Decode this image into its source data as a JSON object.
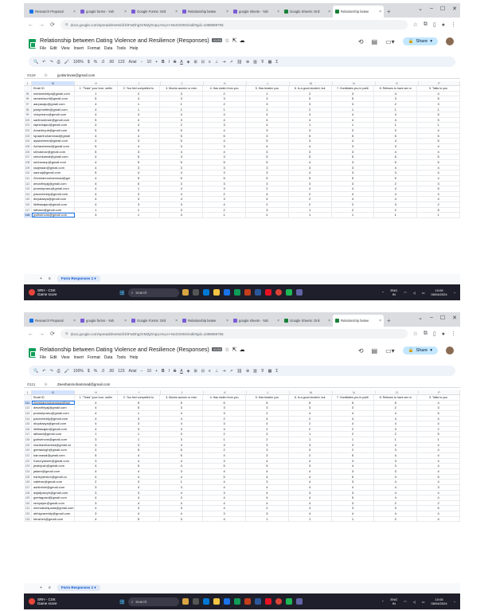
{
  "browser": {
    "tabs": [
      {
        "label": "Research Proposal"
      },
      {
        "label": "google forms - Yah"
      },
      {
        "label": "Google Forms: Onli"
      },
      {
        "label": "Relationship betwe"
      },
      {
        "label": "google sheets - Yah"
      },
      {
        "label": "Google Sheets: Onli"
      },
      {
        "label": "Relationship betwe"
      }
    ],
    "url": "docs.google.com/spreadsheets/d/1hFwDhg3VMZjZmpq-Imq-H-NeO3H5G/edit#gid=1098989706"
  },
  "doc": {
    "title": "Relationship between Dating Violence and Resilience (Responses)",
    "badge": ".XLSX",
    "menus": [
      "File",
      "Edit",
      "View",
      "Insert",
      "Format",
      "Data",
      "Tools",
      "Help"
    ],
    "share_label": "Share"
  },
  "toolbar": {
    "zoom": "100%",
    "font": "Arial",
    "size": "10",
    "currency": "$",
    "percent": "%",
    "decimals1": ".0",
    "decimals2": ".00",
    "num_format": "123"
  },
  "columns": [
    "1",
    "G",
    "H",
    "I",
    "J",
    "K",
    "L",
    "M",
    "N",
    "O",
    "P"
  ],
  "header_cells": [
    "Email ID",
    "1. \"Tests\" your love, settin",
    "2. You feel compelled to",
    "3. Mocks women or men",
    "4. Has stolen from you",
    "5. Has beaten you",
    "6. Is a good student, but",
    "7. Humiliates you in publi",
    "8. Refuses to have sex w",
    "9. Talks to you"
  ],
  "screen1": {
    "cell_ref": "G118",
    "formula": "jyotisrinvas@gmail.com",
    "rows": [
      {
        "n": "95",
        "cells": [
          "neelamshilpa@gmail.com",
          "1",
          "2",
          "3",
          "2",
          "1",
          "2",
          "3",
          "4",
          "4"
        ]
      },
      {
        "n": "96",
        "cells": [
          "rameshsurii@gmail.com",
          "5",
          "4",
          "3",
          "3",
          "3",
          "5",
          "5",
          "3",
          "5"
        ]
      },
      {
        "n": "97",
        "cells": [
          "aaryasaju@gmail.com",
          "4",
          "1",
          "1",
          "2",
          "3",
          "3",
          "3",
          "2",
          "3"
        ]
      },
      {
        "n": "98",
        "cells": [
          "josephmtitri@gmail.com",
          "4",
          "1",
          "1",
          "1",
          "1",
          "2",
          "1",
          "1",
          "1"
        ]
      },
      {
        "n": "99",
        "cells": [
          "vickymanu@gmail.com",
          "4",
          "4",
          "4",
          "4",
          "4",
          "4",
          "4",
          "4",
          "5"
        ]
      },
      {
        "n": "100",
        "cells": [
          "santhoshnair@gmail.com",
          "5",
          "4",
          "3",
          "4",
          "4",
          "4",
          "4",
          "4",
          "5"
        ]
      },
      {
        "n": "101",
        "cells": [
          "rajeshrajau@gmail.com",
          "4",
          "4",
          "2",
          "3",
          "4",
          "1",
          "1",
          "1",
          "1"
        ]
      },
      {
        "n": "102",
        "cells": [
          "Amanleyub@gmail.com",
          "5",
          "5",
          "5",
          "4",
          "3",
          "3",
          "3",
          "3",
          "4"
        ]
      },
      {
        "n": "103",
        "cells": [
          "Iqraamhohammad@gmail",
          "4",
          "4",
          "5",
          "5",
          "3",
          "5",
          "5",
          "5",
          "5"
        ]
      },
      {
        "n": "104",
        "cells": [
          "ayazahmed@gmail.com",
          "4",
          "3",
          "5",
          "4",
          "5",
          "3",
          "4",
          "4",
          "5"
        ]
      },
      {
        "n": "105",
        "cells": [
          "Azharahmad@gmail.com",
          "5",
          "4",
          "3",
          "3",
          "4",
          "4",
          "3",
          "3",
          "4"
        ]
      },
      {
        "n": "106",
        "cells": [
          "shivashav@gmail.com",
          "5",
          "3",
          "4",
          "4",
          "3",
          "3",
          "3",
          "4",
          "4"
        ]
      },
      {
        "n": "107",
        "cells": [
          "simonkamal@gmail.com",
          "4",
          "5",
          "3",
          "3",
          "5",
          "5",
          "5",
          "5",
          "5"
        ]
      },
      {
        "n": "108",
        "cells": [
          "sricharanp@gmail.com",
          "4",
          "5",
          "5",
          "5",
          "5",
          "4",
          "3",
          "5",
          "5"
        ]
      },
      {
        "n": "109",
        "cells": [
          "raajmaan@gmail.com",
          "4",
          "3",
          "3",
          "3",
          "3",
          "3",
          "3",
          "4",
          "4"
        ]
      },
      {
        "n": "110",
        "cells": [
          "sannaj@gmail.com",
          "5",
          "4",
          "4",
          "3",
          "3",
          "4",
          "3",
          "3",
          "4"
        ]
      },
      {
        "n": "111",
        "cells": [
          "Zeeshanmohammad@gm",
          "4",
          "5",
          "5",
          "5",
          "5",
          "5",
          "5",
          "5",
          "4"
        ]
      },
      {
        "n": "112",
        "cells": [
          "devarthiyaj@gmail.com",
          "4",
          "5",
          "3",
          "3",
          "3",
          "3",
          "3",
          "2",
          "3"
        ]
      },
      {
        "n": "113",
        "cells": [
          "pranshpranu@gmail.com",
          "4",
          "1",
          "4",
          "3",
          "2",
          "4",
          "4",
          "4",
          "5"
        ]
      },
      {
        "n": "114",
        "cells": [
          "pavanreddy@gmail.com",
          "4",
          "3",
          "4",
          "2",
          "4",
          "2",
          "4",
          "4",
          "4"
        ]
      },
      {
        "n": "115",
        "cells": [
          "divyalaaya@gmail.com",
          "4",
          "3",
          "4",
          "3",
          "4",
          "2",
          "4",
          "4",
          "4"
        ]
      },
      {
        "n": "116",
        "cells": [
          "likithasajan@gmail.com",
          "4",
          "3",
          "3",
          "4",
          "2",
          "2",
          "2",
          "3",
          "2"
        ]
      },
      {
        "n": "117",
        "cells": [
          "lathasri@gmail.com",
          "1",
          "1",
          "3",
          "2",
          "3",
          "1",
          "2",
          "2",
          "5"
        ]
      },
      {
        "n": "118",
        "cells": [
          "jyotisrinvas@gmail.com",
          "3",
          "1",
          "3",
          "1",
          "2",
          "1",
          "1",
          "1",
          "1"
        ]
      }
    ]
  },
  "screen2": {
    "cell_ref": "G111",
    "formula": "Zeeshanmohammad@gmail.com",
    "rows": [
      {
        "n": "111",
        "cells": [
          "Zeeshanmohammad@gm",
          "4",
          "5",
          "5",
          "5",
          "5",
          "5",
          "5",
          "5",
          "4"
        ]
      },
      {
        "n": "112",
        "cells": [
          "devarthiyaj@gmail.com",
          "4",
          "5",
          "3",
          "3",
          "3",
          "3",
          "3",
          "2",
          "3"
        ]
      },
      {
        "n": "113",
        "cells": [
          "pranshpranu@gmail.com",
          "4",
          "1",
          "4",
          "3",
          "2",
          "4",
          "4",
          "4",
          "5"
        ]
      },
      {
        "n": "114",
        "cells": [
          "pavanreddy@gmail.com",
          "4",
          "3",
          "4",
          "2",
          "4",
          "2",
          "4",
          "4",
          "4"
        ]
      },
      {
        "n": "115",
        "cells": [
          "divyalaaya@gmail.com",
          "4",
          "3",
          "4",
          "3",
          "4",
          "2",
          "4",
          "4",
          "4"
        ]
      },
      {
        "n": "116",
        "cells": [
          "likithasajan@gmail.com",
          "4",
          "3",
          "3",
          "4",
          "2",
          "2",
          "2",
          "3",
          "2"
        ]
      },
      {
        "n": "117",
        "cells": [
          "lathasri@gmail.com",
          "1",
          "1",
          "3",
          "2",
          "3",
          "1",
          "2",
          "2",
          "5"
        ]
      },
      {
        "n": "118",
        "cells": [
          "jyotisrinvas@gmail.com",
          "3",
          "1",
          "3",
          "1",
          "2",
          "1",
          "1",
          "1",
          "1"
        ]
      },
      {
        "n": "119",
        "cells": [
          "madhavihansha@gmail.co",
          "3",
          "3",
          "4",
          "3",
          "3",
          "3",
          "3",
          "4",
          "4"
        ]
      },
      {
        "n": "120",
        "cells": [
          "geetasingh@gmail.com",
          "4",
          "5",
          "5",
          "2",
          "3",
          "3",
          "2",
          "3",
          "4"
        ]
      },
      {
        "n": "121",
        "cells": [
          "karunasai@gmail.com",
          "5",
          "4",
          "5",
          "4",
          "3",
          "2",
          "5",
          "4",
          "4"
        ]
      },
      {
        "n": "122",
        "cells": [
          "Karunyasree@gmail.com",
          "3",
          "4",
          "4",
          "3",
          "4",
          "4",
          "3",
          "3",
          "4"
        ]
      },
      {
        "n": "123",
        "cells": [
          "jestinjosh@gmail.com",
          "4",
          "5",
          "4",
          "5",
          "5",
          "3",
          "4",
          "3",
          "4"
        ]
      },
      {
        "n": "124",
        "cells": [
          "jadam@gmail.com",
          "4",
          "4",
          "3",
          "4",
          "4",
          "4",
          "3",
          "3",
          "4"
        ]
      },
      {
        "n": "125",
        "cells": [
          "harleydeston@gmail.co",
          "4",
          "4",
          "4",
          "5",
          "4",
          "4",
          "5",
          "3",
          "5"
        ]
      },
      {
        "n": "126",
        "cells": [
          "vaibhav@gmail.com",
          "2",
          "3",
          "1",
          "4",
          "3",
          "4",
          "3",
          "4",
          "4"
        ]
      },
      {
        "n": "127",
        "cells": [
          "ashlinfahi@gmail.com",
          "3",
          "4",
          "4",
          "4",
          "4",
          "4",
          "4",
          "4",
          "3"
        ]
      },
      {
        "n": "128",
        "cells": [
          "anjalijoseph@gmail.com",
          "3",
          "3",
          "4",
          "3",
          "4",
          "3",
          "3",
          "4",
          "4"
        ]
      },
      {
        "n": "129",
        "cells": [
          "geetagowd@gmail.com",
          "4",
          "4",
          "3",
          "4",
          "4",
          "4",
          "5",
          "4",
          "4"
        ]
      },
      {
        "n": "130",
        "cells": [
          "ramyayer@gmail.com",
          "3",
          "4",
          "4",
          "4",
          "4",
          "4",
          "3",
          "2",
          "2"
        ]
      },
      {
        "n": "131",
        "cells": [
          "meenakshipada@gmail.com",
          "4",
          "3",
          "3",
          "4",
          "2",
          "4",
          "3",
          "3",
          "5"
        ]
      },
      {
        "n": "132",
        "cells": [
          "abhigvareddy@gmail.com",
          "3",
          "4",
          "4",
          "3",
          "3",
          "4",
          "4",
          "4",
          "4"
        ]
      },
      {
        "n": "133",
        "cells": [
          "khushirs@gmail.com",
          "4",
          "5",
          "3",
          "4",
          "1",
          "1",
          "1",
          "2",
          "4"
        ]
      }
    ]
  },
  "sheet_tab": "Form Responses 1",
  "taskbar": {
    "weather_line1": "SRH - CSK",
    "weather_line2": "Game score",
    "search": "Search",
    "lang1": "ENG",
    "lang2": "IN",
    "time": "10:05",
    "date": "06/04/2024"
  }
}
